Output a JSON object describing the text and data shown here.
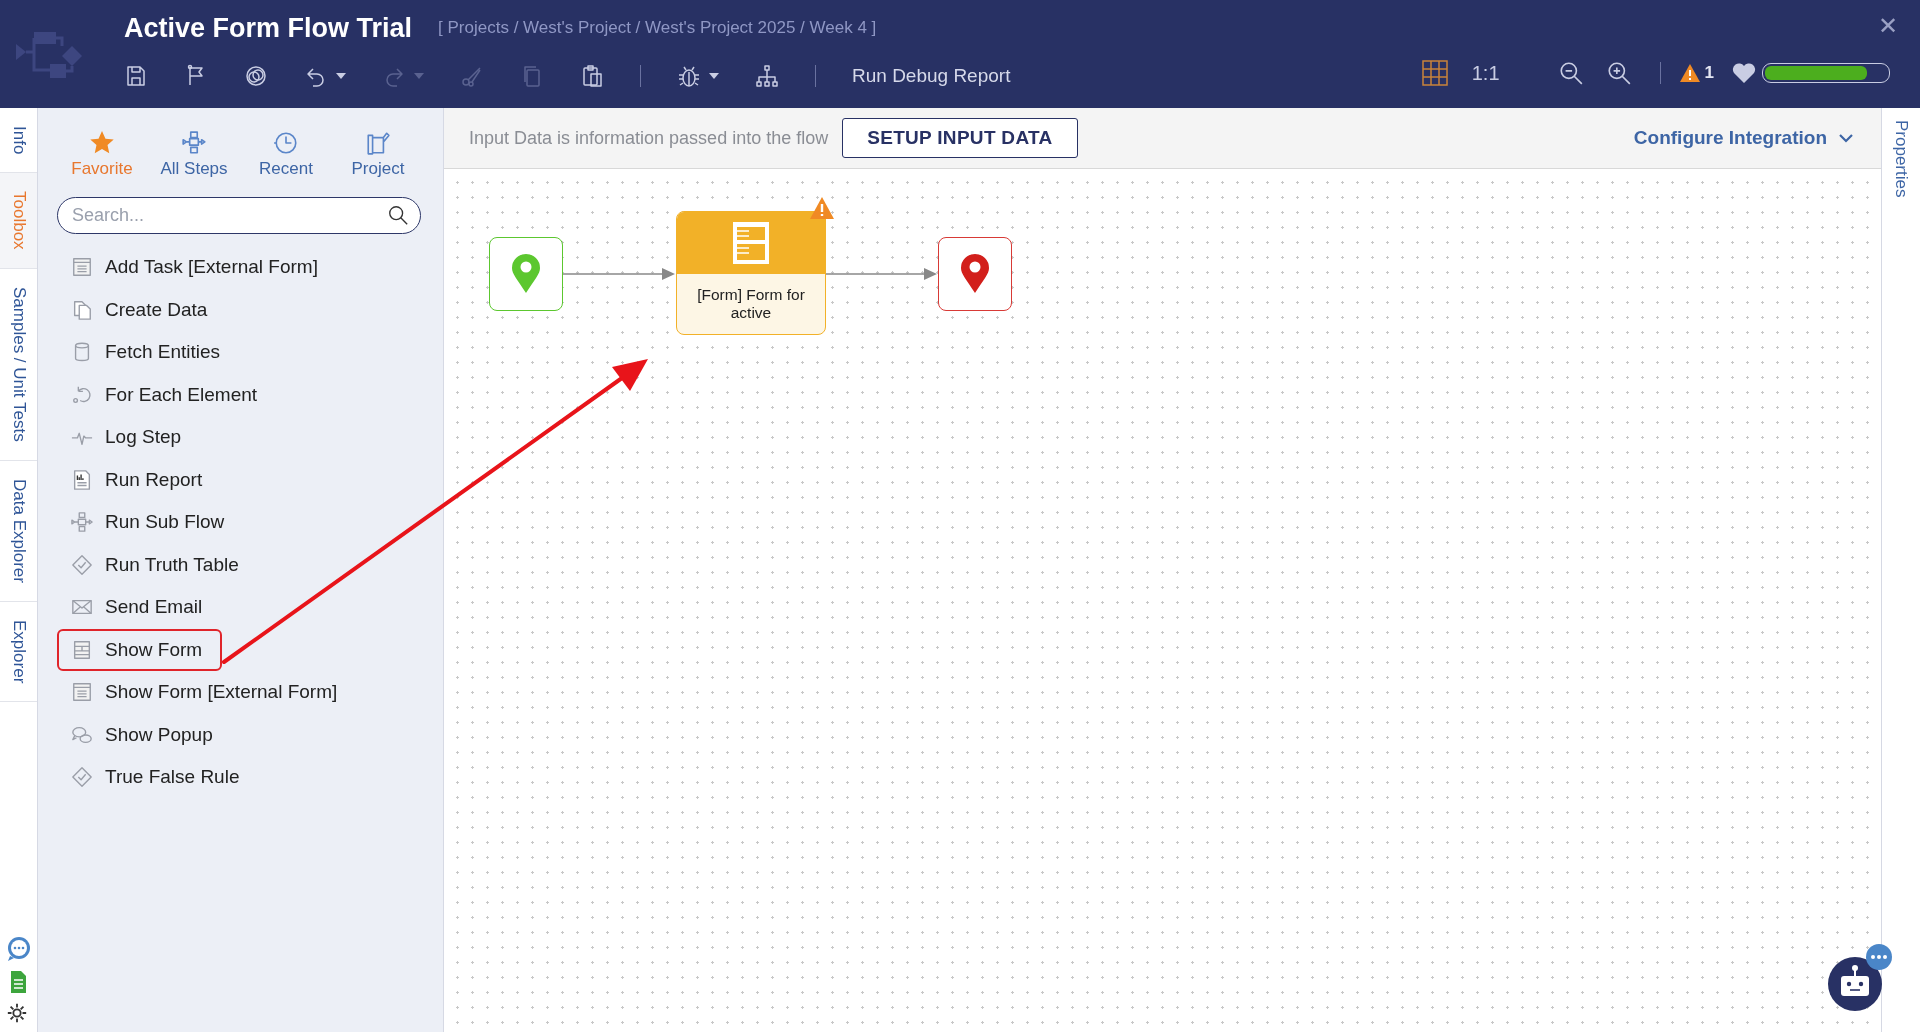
{
  "header": {
    "title": "Active Form Flow Trial",
    "breadcrumb": "[ Projects / West's Project / West's Project 2025 / Week 4 ]",
    "close": "✕",
    "tools": [
      {
        "kind": "save",
        "disabled": false,
        "menu": false
      },
      {
        "kind": "flag",
        "disabled": false,
        "menu": false
      },
      {
        "kind": "circles",
        "disabled": false,
        "menu": false
      },
      {
        "kind": "undo",
        "disabled": false,
        "menu": true
      },
      {
        "kind": "redo",
        "disabled": true,
        "menu": true
      },
      {
        "kind": "cut",
        "disabled": true,
        "menu": false
      },
      {
        "kind": "copy",
        "disabled": true,
        "menu": false
      },
      {
        "kind": "paste",
        "disabled": false,
        "menu": false
      },
      {
        "kind": "sep"
      },
      {
        "kind": "bug",
        "disabled": false,
        "menu": true
      },
      {
        "kind": "tree",
        "disabled": false,
        "menu": false
      },
      {
        "kind": "sep"
      }
    ],
    "debug_report": "Run Debug Report",
    "zoom_reset": "1:1",
    "warning_count": "1",
    "health": {
      "level": 0.84
    }
  },
  "side_tabs": [
    {
      "label": "Info",
      "selected": false
    },
    {
      "label": "Toolbox",
      "selected": true
    },
    {
      "label": "Samples / Unit Tests",
      "selected": false
    },
    {
      "label": "Data Explorer",
      "selected": false
    },
    {
      "label": "Explorer",
      "selected": false
    }
  ],
  "toolbox": {
    "tabs": [
      {
        "label": "Favorite",
        "kind": "star",
        "selected": true
      },
      {
        "label": "All Steps",
        "kind": "steps",
        "selected": false
      },
      {
        "label": "Recent",
        "kind": "clock",
        "selected": false
      },
      {
        "label": "Project",
        "kind": "project",
        "selected": false
      }
    ],
    "search": {
      "placeholder": "Search..."
    },
    "items": [
      {
        "label": "Add Task [External Form]",
        "kind": "extform",
        "highlighted": false
      },
      {
        "label": "Create Data",
        "kind": "copy",
        "highlighted": false
      },
      {
        "label": "Fetch Entities",
        "kind": "cylinder",
        "highlighted": false
      },
      {
        "label": "For Each Element",
        "kind": "loop",
        "highlighted": false
      },
      {
        "label": "Log Step",
        "kind": "pulse",
        "highlighted": false
      },
      {
        "label": "Run Report",
        "kind": "report",
        "highlighted": false
      },
      {
        "label": "Run Sub Flow",
        "kind": "subflow",
        "highlighted": false
      },
      {
        "label": "Run Truth Table",
        "kind": "check",
        "highlighted": false
      },
      {
        "label": "Send Email",
        "kind": "mail",
        "highlighted": false
      },
      {
        "label": "Show Form",
        "kind": "form",
        "highlighted": true
      },
      {
        "label": "Show Form [External Form]",
        "kind": "extform",
        "highlighted": false
      },
      {
        "label": "Show Popup",
        "kind": "popup",
        "highlighted": false
      },
      {
        "label": "True False Rule",
        "kind": "check",
        "highlighted": false
      }
    ]
  },
  "input_bar": {
    "hint": "Input Data is information passed into the flow",
    "button": "SETUP INPUT DATA",
    "configure": "Configure Integration"
  },
  "right_tabs": [
    {
      "label": "Properties"
    }
  ],
  "flow": {
    "nodes": [
      {
        "kind": "start"
      },
      {
        "kind": "form",
        "label": "[Form] Form for active",
        "warning": true
      },
      {
        "kind": "end"
      }
    ]
  }
}
